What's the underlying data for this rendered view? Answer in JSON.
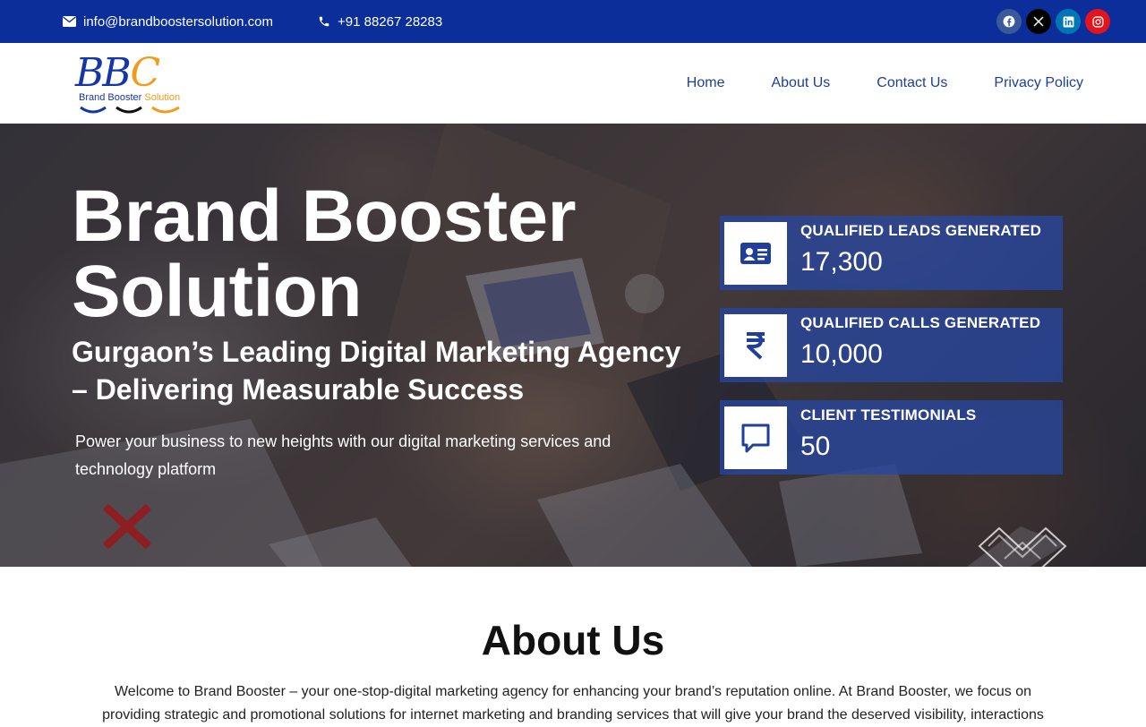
{
  "topbar": {
    "email": "info@brandboostersolution.com",
    "phone": "+91 88267 28283",
    "social": [
      {
        "name": "facebook-icon",
        "color": "#3b5998"
      },
      {
        "name": "x-icon",
        "color": "#000000"
      },
      {
        "name": "linkedin-icon",
        "color": "#0077b5"
      },
      {
        "name": "instagram-icon",
        "color": "#e4141d"
      }
    ]
  },
  "logo": {
    "letters_1": "B",
    "letters_2": "B",
    "letters_3": "C",
    "text_1": "Brand Booster ",
    "text_2": "Solution"
  },
  "nav": {
    "items": [
      {
        "label": "Home"
      },
      {
        "label": "About Us"
      },
      {
        "label": "Contact Us"
      },
      {
        "label": "Privacy Policy"
      }
    ]
  },
  "hero": {
    "title_line1": "Brand Booster",
    "title_line2": "Solution",
    "subtitle": "Gurgaon’s Leading Digital Marketing Agency – Delivering Measurable Success",
    "tagline": "Power your business to new heights with our digital marketing services and technology platform"
  },
  "stats": [
    {
      "label": "QUALIFIED LEADS GENERATED",
      "value": "17,300",
      "icon": "id-card-icon"
    },
    {
      "label": "QUALIFIED CALLS GENERATED",
      "value": "10,000",
      "icon": "rupee-icon"
    },
    {
      "label": "CLIENT TESTIMONIALS",
      "value": "50",
      "icon": "chat-icon"
    }
  ],
  "about": {
    "title": "About Us",
    "text": "Welcome to Brand Booster – your one-stop-digital marketing agency for enhancing your brand’s reputation online. At Brand Booster, we focus on providing strategic and promotional solutions for internet marketing and branding services that will give your brand the deserved visibility, interactions"
  },
  "colors": {
    "topbar": "#0b2e9b",
    "nav_link": "#1e3f99",
    "stat_bg": "#2846a0",
    "stat_icon": "#1f3f9a"
  }
}
